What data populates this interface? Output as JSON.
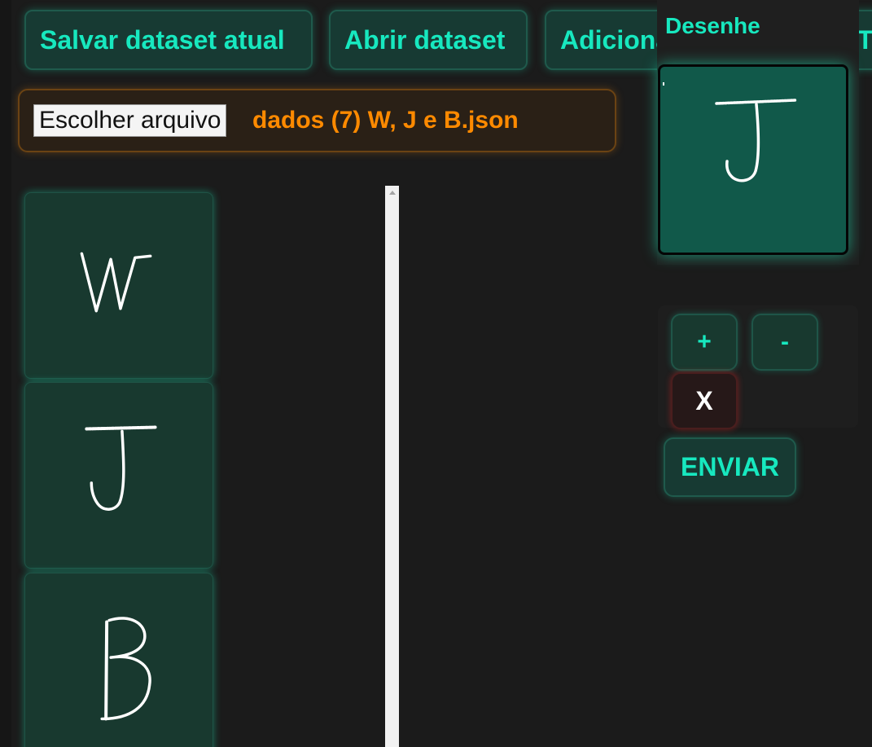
{
  "toolbar": {
    "save_label": "Salvar dataset atual",
    "open_label": "Abrir dataset",
    "add_label": "Adicionar desenho",
    "train_label": "Treinar"
  },
  "file_input": {
    "button_label": "Escolher arquivo",
    "file_name": "dados (7) W, J e B.json"
  },
  "dataset": {
    "items": [
      {
        "glyph": "W"
      },
      {
        "glyph": "J"
      },
      {
        "glyph": "B"
      }
    ]
  },
  "draw": {
    "label": "Desenhe",
    "current_glyph": "J"
  },
  "controls": {
    "plus_label": "+",
    "minus_label": "-",
    "clear_label": "X"
  },
  "send": {
    "label": "ENVIAR"
  },
  "colors": {
    "accent": "#17e8bf",
    "file_accent": "#ff8a00",
    "background": "#1b1b1b",
    "card": "#18392f",
    "canvas": "#11594a",
    "danger": "#c62828"
  },
  "icons": {
    "scroll_up": "scroll-up-arrow-icon"
  }
}
